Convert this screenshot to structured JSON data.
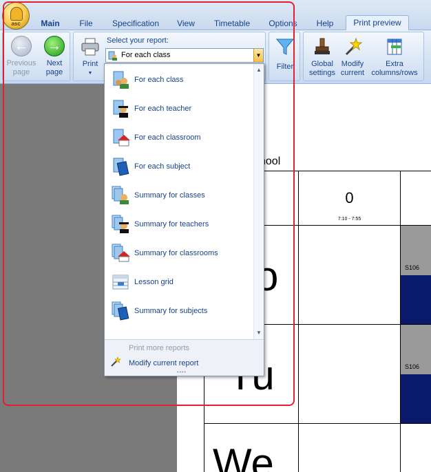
{
  "app": {
    "orb_label": "asc"
  },
  "tabs": [
    {
      "label": "Main"
    },
    {
      "label": "File"
    },
    {
      "label": "Specification"
    },
    {
      "label": "View"
    },
    {
      "label": "Timetable"
    },
    {
      "label": "Options"
    },
    {
      "label": "Help"
    },
    {
      "label": "Print preview"
    }
  ],
  "ribbon": {
    "previous_page": "Previous page",
    "next_page": "Next page",
    "print": "Print",
    "select_report_label": "Select your report:",
    "selected_report": "For each class",
    "filter": "Filter",
    "global_settings": "Global settings",
    "modify_current": "Modify current",
    "extra_columns_rows": "Extra columns/rows"
  },
  "report_options": [
    {
      "label": "For each class",
      "icon": "class-students-icon"
    },
    {
      "label": "For each teacher",
      "icon": "teacher-icon"
    },
    {
      "label": "For each classroom",
      "icon": "classroom-icon"
    },
    {
      "label": "For each subject",
      "icon": "subject-book-icon"
    },
    {
      "label": "Summary for classes",
      "icon": "classes-summary-icon"
    },
    {
      "label": "Summary for teachers",
      "icon": "teachers-summary-icon"
    },
    {
      "label": "Summary for classrooms",
      "icon": "classrooms-summary-icon"
    },
    {
      "label": "Lesson grid",
      "icon": "lesson-grid-icon"
    },
    {
      "label": "Summary for subjects",
      "icon": "subjects-summary-icon"
    }
  ],
  "dropdown_footer": {
    "print_more": "Print more reports",
    "modify_current_report": "Modify current report"
  },
  "preview": {
    "school_text": "chool",
    "period_number": "0",
    "period_time": "7:10 - 7:55",
    "day_mo": "o",
    "day_tu": "Tu",
    "day_we": "We",
    "room_1": "S106",
    "room_2": "S106"
  },
  "colors": {
    "highlight": "#e0202c",
    "lesson_cell": "#0a1a6a",
    "ribbon_text": "#15428b"
  }
}
